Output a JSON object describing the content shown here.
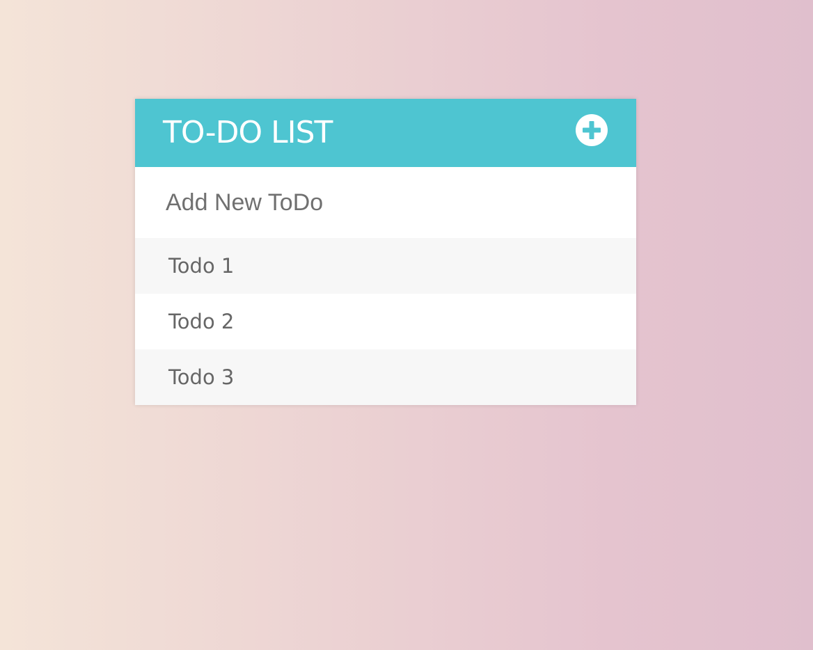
{
  "header": {
    "title": "TO-DO LIST",
    "add_icon": "plus-circle-icon"
  },
  "input": {
    "placeholder": "Add New ToDo",
    "value": ""
  },
  "todos": [
    {
      "label": "Todo 1"
    },
    {
      "label": "Todo 2"
    },
    {
      "label": "Todo 3"
    }
  ],
  "colors": {
    "header_bg": "#4ec5d1",
    "accent": "#4ec5d1",
    "text": "#666666",
    "row_alt": "#f7f7f7"
  }
}
